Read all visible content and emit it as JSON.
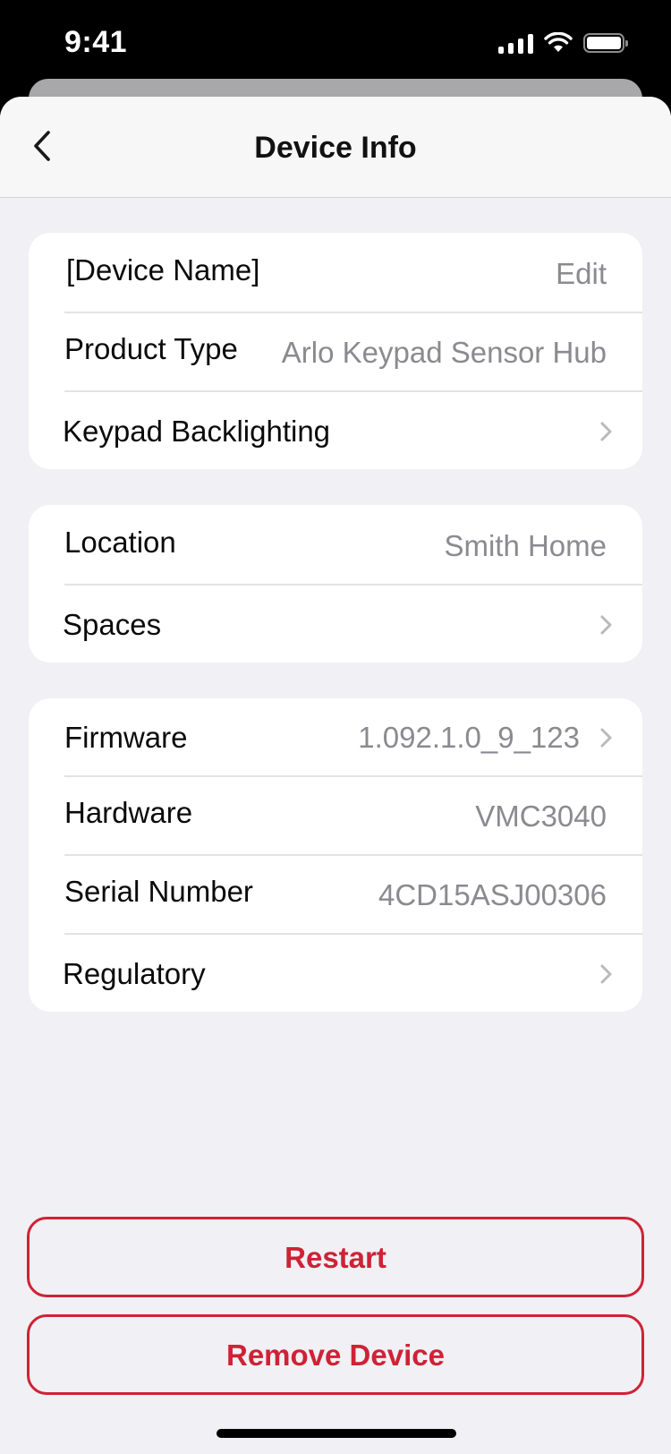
{
  "status_bar": {
    "time": "9:41"
  },
  "nav": {
    "title": "Device Info",
    "back_icon": "chevron-left-icon"
  },
  "group1": {
    "device_name": {
      "label": "[Device Name]",
      "value": "Edit"
    },
    "product_type": {
      "label": "Product Type",
      "value": "Arlo Keypad Sensor Hub"
    },
    "keypad_backlighting": {
      "label": "Keypad Backlighting"
    }
  },
  "group2": {
    "location": {
      "label": "Location",
      "value": "Smith Home"
    },
    "spaces": {
      "label": "Spaces"
    }
  },
  "group3": {
    "firmware": {
      "label": "Firmware",
      "value": "1.092.1.0_9_123"
    },
    "hardware": {
      "label": "Hardware",
      "value": "VMC3040"
    },
    "serial_number": {
      "label": "Serial Number",
      "value": "4CD15ASJ00306"
    },
    "regulatory": {
      "label": "Regulatory"
    }
  },
  "actions": {
    "restart_label": "Restart",
    "remove_label": "Remove Device"
  },
  "colors": {
    "accent_red": "#cf2235",
    "secondary_text": "#8a8a90",
    "background": "#f0f0f5"
  }
}
